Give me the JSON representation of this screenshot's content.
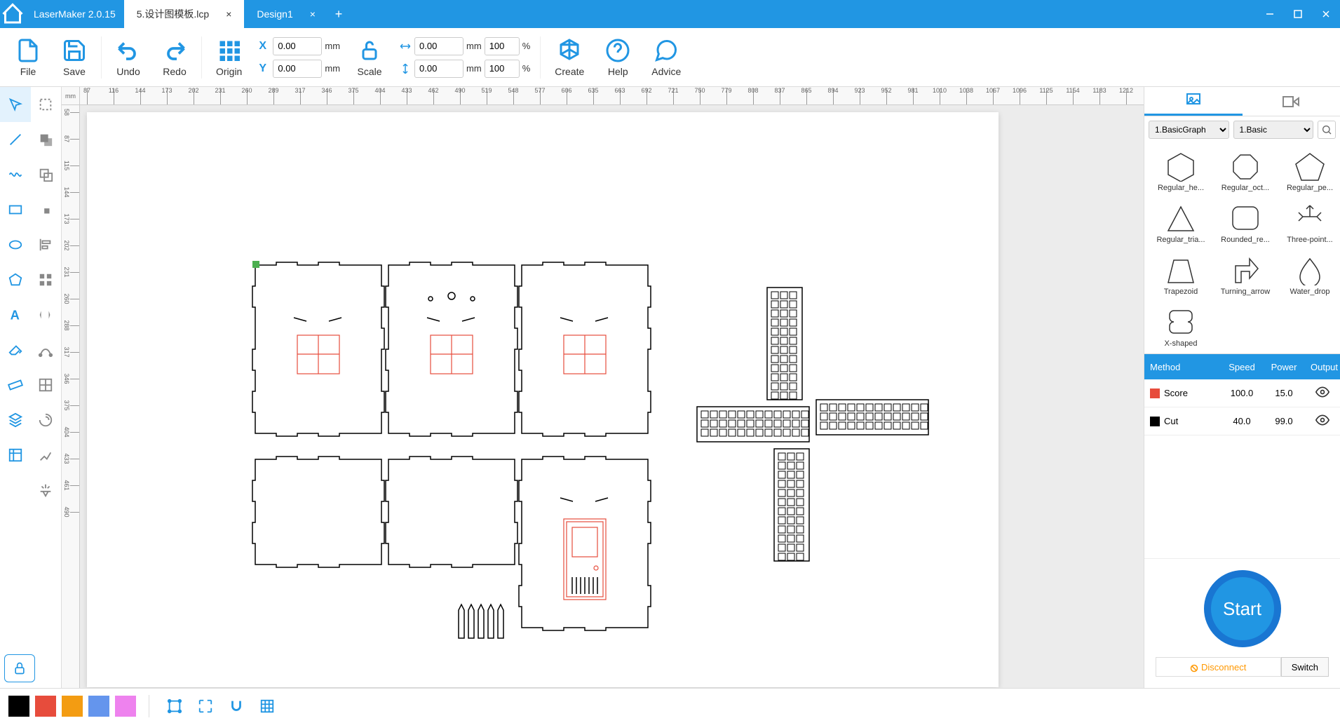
{
  "app_title": "LaserMaker 2.0.15",
  "tabs": [
    {
      "label": "5.设计图模板.lcp",
      "active": true
    },
    {
      "label": "Design1",
      "active": false
    }
  ],
  "toolbar": {
    "file": "File",
    "save": "Save",
    "undo": "Undo",
    "redo": "Redo",
    "origin": "Origin",
    "scale": "Scale",
    "create": "Create",
    "help": "Help",
    "advice": "Advice"
  },
  "coords": {
    "x_label": "X",
    "x_value": "0.00",
    "y_label": "Y",
    "y_value": "0.00",
    "unit": "mm",
    "w_value": "0.00",
    "h_value": "0.00",
    "w_pct": "100",
    "h_pct": "100",
    "pct": "%"
  },
  "ruler_unit": "mm",
  "ruler_h_ticks": [
    87,
    116,
    144,
    173,
    202,
    231,
    260,
    289,
    317,
    346,
    375,
    404,
    433,
    462,
    490,
    519,
    548,
    577,
    606,
    635,
    663,
    692,
    721,
    750,
    779,
    808,
    837,
    865,
    894,
    923,
    952,
    981,
    1010,
    1038,
    1067,
    1096,
    1125,
    1154,
    1183,
    1212
  ],
  "ruler_v_ticks": [
    58,
    87,
    115,
    144,
    173,
    202,
    231,
    260,
    288,
    317,
    346,
    375,
    404,
    433,
    461,
    490
  ],
  "shape_library": {
    "category1": "1.BasicGraph",
    "category2": "1.Basic",
    "shapes": [
      "Regular_he...",
      "Regular_oct...",
      "Regular_pe...",
      "Regular_tria...",
      "Rounded_re...",
      "Three-point...",
      "Trapezoid",
      "Turning_arrow",
      "Water_drop",
      "X-shaped"
    ]
  },
  "layers": {
    "headers": {
      "method": "Method",
      "speed": "Speed",
      "power": "Power",
      "output": "Output"
    },
    "rows": [
      {
        "color": "#e74c3c",
        "method": "Score",
        "speed": "100.0",
        "power": "15.0"
      },
      {
        "color": "#000000",
        "method": "Cut",
        "speed": "40.0",
        "power": "99.0"
      }
    ]
  },
  "start_label": "Start",
  "disconnect_label": "Disconnect",
  "switch_label": "Switch",
  "color_palette": [
    "#000000",
    "#e74c3c",
    "#f39c12",
    "#6495ed",
    "#ee82ee"
  ]
}
